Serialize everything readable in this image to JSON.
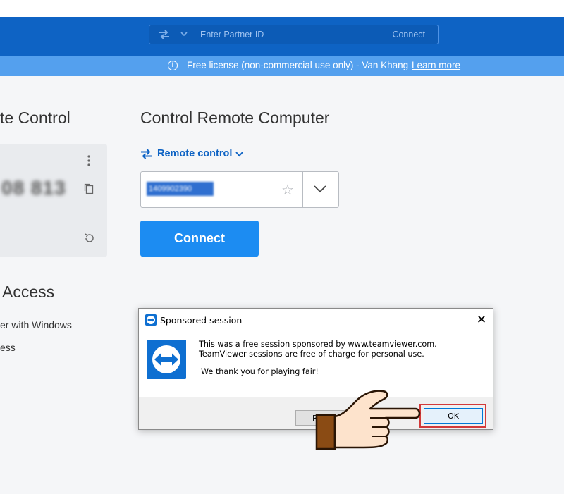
{
  "header": {
    "partner_placeholder": "Enter Partner ID",
    "connect_label": "Connect"
  },
  "banner": {
    "text": "Free license (non-commercial use only) - Van Khang",
    "link": "Learn more"
  },
  "left": {
    "title": "te Control",
    "id_partial": "08 813",
    "access_title": "Access",
    "link_windows": "er with Windows",
    "link_access": "ess"
  },
  "control": {
    "title": "Control Remote Computer",
    "mode_label": "Remote control",
    "partner_id_value": "1409902390",
    "connect_button": "Connect"
  },
  "dialog": {
    "title": "Sponsored session",
    "line1": "This was a free session sponsored by www.teamviewer.com.",
    "line2": "TeamViewer sessions are free of charge for personal use.",
    "line3": "We thank you for playing fair!",
    "button_partial": "R",
    "ok_label": "OK"
  },
  "colors": {
    "brand_blue": "#0e63c4",
    "banner_blue": "#54a0ee",
    "connect_blue": "#1c8cf2",
    "highlight_red": "#d23a3a"
  },
  "icons": [
    "swap-arrows-icon",
    "chevron-down-icon",
    "info-icon",
    "more-vertical-icon",
    "copy-icon",
    "refresh-icon",
    "star-icon",
    "teamviewer-logo-icon",
    "close-icon",
    "pointing-hand-icon"
  ]
}
